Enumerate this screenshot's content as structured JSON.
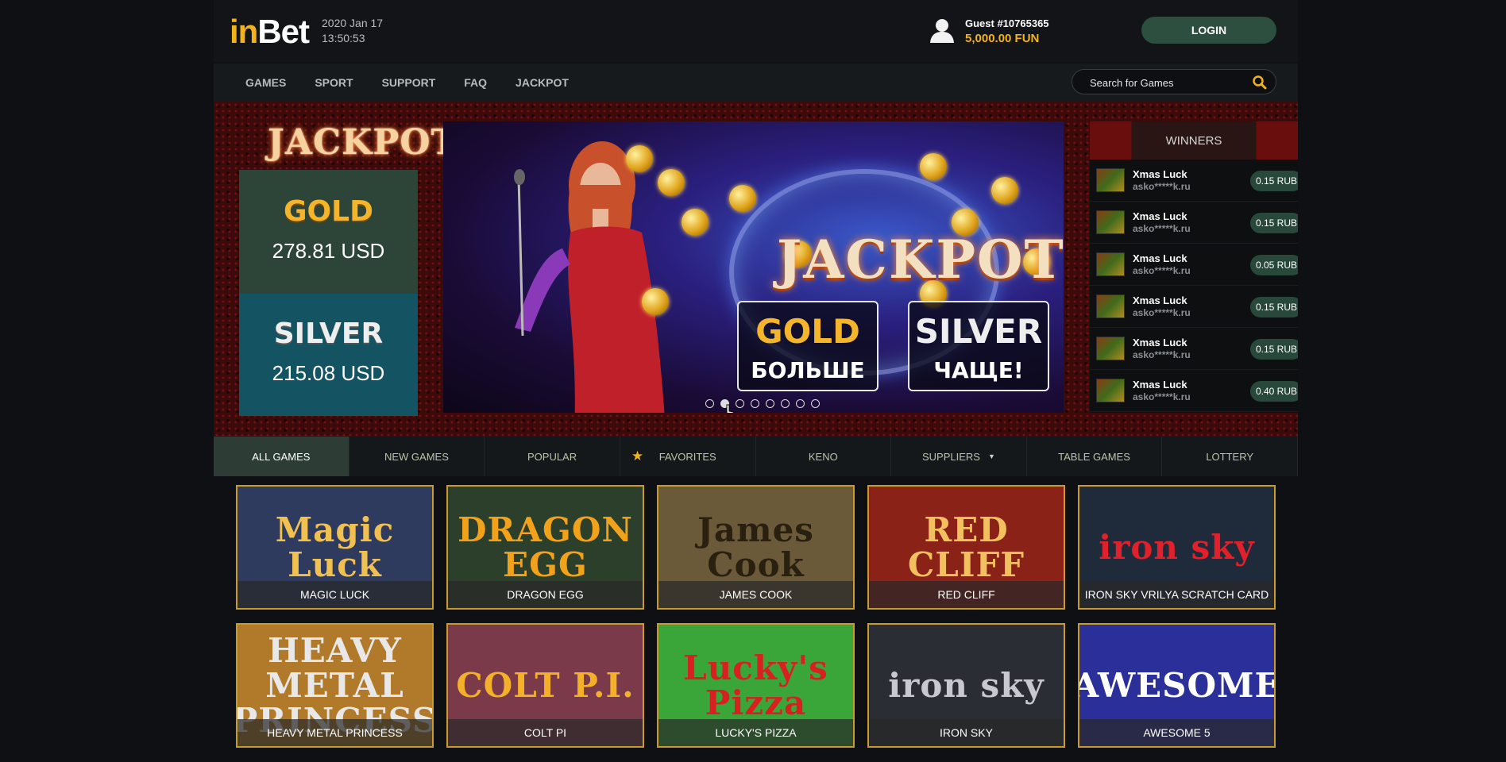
{
  "header": {
    "logo_i": "in",
    "logo_rest": "Bet",
    "date": "2020 Jan 17",
    "time": "13:50:53",
    "guest": "Guest #10765365",
    "balance": "5,000.00 FUN",
    "login_label": "LOGIN"
  },
  "nav": {
    "items": [
      "GAMES",
      "SPORT",
      "SUPPORT",
      "FAQ",
      "JACKPOT"
    ],
    "search_placeholder": "Search for Games"
  },
  "jackpot": {
    "title": "JACKPOT",
    "gold_name": "GOLD",
    "gold_value": "278.81 USD",
    "silver_name": "SILVER",
    "silver_value": "215.08 USD"
  },
  "banner": {
    "title": "JACKPOT",
    "gold_title": "GOLD",
    "gold_sub": "БОЛЬШЕ",
    "silver_title": "SILVER",
    "silver_sub": "ЧАЩЕ!",
    "slide_count": 8,
    "active_slide": 2
  },
  "winners": {
    "title": "WINNERS",
    "rows": [
      {
        "game": "Xmas Luck",
        "user": "asko*****k.ru",
        "amount": "0.15 RUB"
      },
      {
        "game": "Xmas Luck",
        "user": "asko*****k.ru",
        "amount": "0.15 RUB"
      },
      {
        "game": "Xmas Luck",
        "user": "asko*****k.ru",
        "amount": "0.05 RUB"
      },
      {
        "game": "Xmas Luck",
        "user": "asko*****k.ru",
        "amount": "0.15 RUB"
      },
      {
        "game": "Xmas Luck",
        "user": "asko*****k.ru",
        "amount": "0.15 RUB"
      },
      {
        "game": "Xmas Luck",
        "user": "asko*****k.ru",
        "amount": "0.40 RUB"
      }
    ]
  },
  "tabs": [
    "ALL GAMES",
    "NEW GAMES",
    "POPULAR",
    "FAVORITES",
    "KENO",
    "SUPPLIERS",
    "TABLE GAMES",
    "LOTTERY"
  ],
  "games": [
    {
      "name": "MAGIC LUCK",
      "art": "Magic Luck",
      "bg": "#2e3a5e",
      "fg": "#f0c050"
    },
    {
      "name": "DRAGON EGG",
      "art": "DRAGON EGG",
      "bg": "#2b3f2a",
      "fg": "#f2a21a"
    },
    {
      "name": "JAMES COOK",
      "art": "James Cook",
      "bg": "#6b5a3a",
      "fg": "#2a2010"
    },
    {
      "name": "RED CLIFF",
      "art": "RED CLIFF",
      "bg": "#8a2218",
      "fg": "#f3c060"
    },
    {
      "name": "IRON SKY VRILYA SCRATCH CARD",
      "art": "iron sky",
      "bg": "#1f2b3a",
      "fg": "#e0202a"
    },
    {
      "name": "HEAVY METAL PRINCESS",
      "art": "HEAVY METAL PRINCESS",
      "bg": "#b07a2a",
      "fg": "#e8e8e8"
    },
    {
      "name": "COLT PI",
      "art": "COLT P.I.",
      "bg": "#7a3a4a",
      "fg": "#f5b02a"
    },
    {
      "name": "LUCKY'S PIZZA",
      "art": "Lucky's Pizza",
      "bg": "#3aa63a",
      "fg": "#d82020"
    },
    {
      "name": "IRON SKY",
      "art": "iron sky",
      "bg": "#2a2d33",
      "fg": "#c8c8d0"
    },
    {
      "name": "AWESOME 5",
      "art": "AWESOME",
      "bg": "#2a2f9a",
      "fg": "#ffffff"
    }
  ]
}
